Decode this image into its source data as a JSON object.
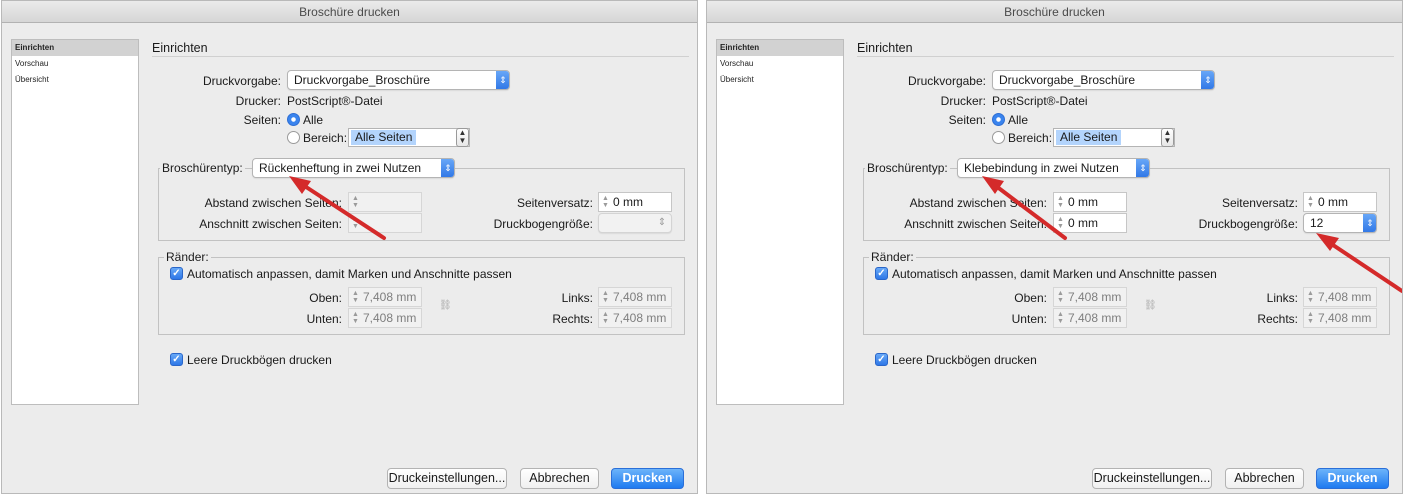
{
  "dialogs": [
    {
      "title": "Broschüre drucken",
      "sidebar": [
        "Einrichten",
        "Vorschau",
        "Übersicht"
      ],
      "section_title": "Einrichten",
      "druckvorgabe_label": "Druckvorgabe:",
      "druckvorgabe_value": "Druckvorgabe_Broschüre",
      "drucker_label": "Drucker:",
      "drucker_value": "PostScript®-Datei",
      "seiten_label": "Seiten:",
      "alle_label": "Alle",
      "bereich_label": "Bereich:",
      "bereich_value": "Alle Seiten",
      "broschuerentyp_label": "Broschürentyp:",
      "broschuerentyp_value": "Rückenheftung in zwei Nutzen",
      "abstand_label": "Abstand zwischen Seiten:",
      "abstand_value": "",
      "anschnitt_label": "Anschnitt zwischen Seiten:",
      "anschnitt_value": "",
      "seitenversatz_label": "Seitenversatz:",
      "seitenversatz_value": "0 mm",
      "druckbogen_label": "Druckbogengröße:",
      "druckbogen_value": "",
      "raender_label": "Ränder:",
      "auto_label": "Automatisch anpassen, damit Marken und Anschnitte passen",
      "oben_label": "Oben:",
      "oben_value": "7,408 mm",
      "unten_label": "Unten:",
      "unten_value": "7,408 mm",
      "links_label": "Links:",
      "links_value": "7,408 mm",
      "rechts_label": "Rechts:",
      "rechts_value": "7,408 mm",
      "leere_label": "Leere Druckbögen drucken",
      "btn_settings": "Druckeinstellungen...",
      "btn_cancel": "Abbrechen",
      "btn_print": "Drucken"
    },
    {
      "title": "Broschüre drucken",
      "sidebar": [
        "Einrichten",
        "Vorschau",
        "Übersicht"
      ],
      "section_title": "Einrichten",
      "druckvorgabe_label": "Druckvorgabe:",
      "druckvorgabe_value": "Druckvorgabe_Broschüre",
      "drucker_label": "Drucker:",
      "drucker_value": "PostScript®-Datei",
      "seiten_label": "Seiten:",
      "alle_label": "Alle",
      "bereich_label": "Bereich:",
      "bereich_value": "Alle Seiten",
      "broschuerentyp_label": "Broschürentyp:",
      "broschuerentyp_value": "Klebebindung in zwei Nutzen",
      "abstand_label": "Abstand zwischen Seiten:",
      "abstand_value": "0 mm",
      "anschnitt_label": "Anschnitt zwischen Seiten:",
      "anschnitt_value": "0 mm",
      "seitenversatz_label": "Seitenversatz:",
      "seitenversatz_value": "0 mm",
      "druckbogen_label": "Druckbogengröße:",
      "druckbogen_value": "12",
      "raender_label": "Ränder:",
      "auto_label": "Automatisch anpassen, damit Marken und Anschnitte passen",
      "oben_label": "Oben:",
      "oben_value": "7,408 mm",
      "unten_label": "Unten:",
      "unten_value": "7,408 mm",
      "links_label": "Links:",
      "links_value": "7,408 mm",
      "rechts_label": "Rechts:",
      "rechts_value": "7,408 mm",
      "leere_label": "Leere Druckbögen drucken",
      "btn_settings": "Druckeinstellungen...",
      "btn_cancel": "Abbrechen",
      "btn_print": "Drucken"
    }
  ],
  "colors": {
    "annotation_arrow": "#d42a2a",
    "accent": "#2f76e6",
    "dialog_bg": "#ececec"
  }
}
